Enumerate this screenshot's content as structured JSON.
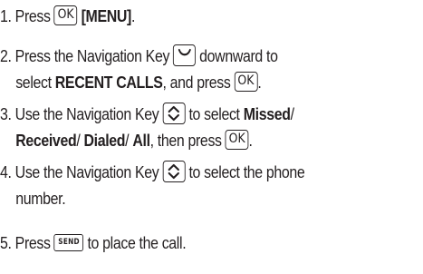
{
  "steps": [
    {
      "num": "1.",
      "t1": "Press",
      "ok_label": "OK",
      "t2": "[MENU]",
      "t3": "."
    },
    {
      "num": "2.",
      "t1": "Press the Navigation Key",
      "t2": "downward to",
      "t3": "select",
      "t4": "RECENT CALLS",
      "t5": ", and press",
      "ok_label": "OK",
      "t6": "."
    },
    {
      "num": "3.",
      "t1": "Use the Navigation Key",
      "t2": "to select",
      "t3": "Missed",
      "t4": "/",
      "t5": "Received",
      "t6": "/",
      "t7": "Dialed",
      "t8": "/",
      "t9": "All",
      "t10": ", then press",
      "ok_label": "OK",
      "t11": "."
    },
    {
      "num": "4.",
      "t1": "Use the Navigation Key",
      "t2": "to select the phone",
      "t3": "number."
    },
    {
      "num": "5.",
      "t1": "Press",
      "send_label": "SEND",
      "t2": "to place the call."
    }
  ],
  "icons": {
    "ok_key": "ok-key-icon",
    "nav_down": "navigation-key-down-icon",
    "nav_updown": "navigation-key-up-down-icon",
    "send_key": "send-key-icon"
  }
}
